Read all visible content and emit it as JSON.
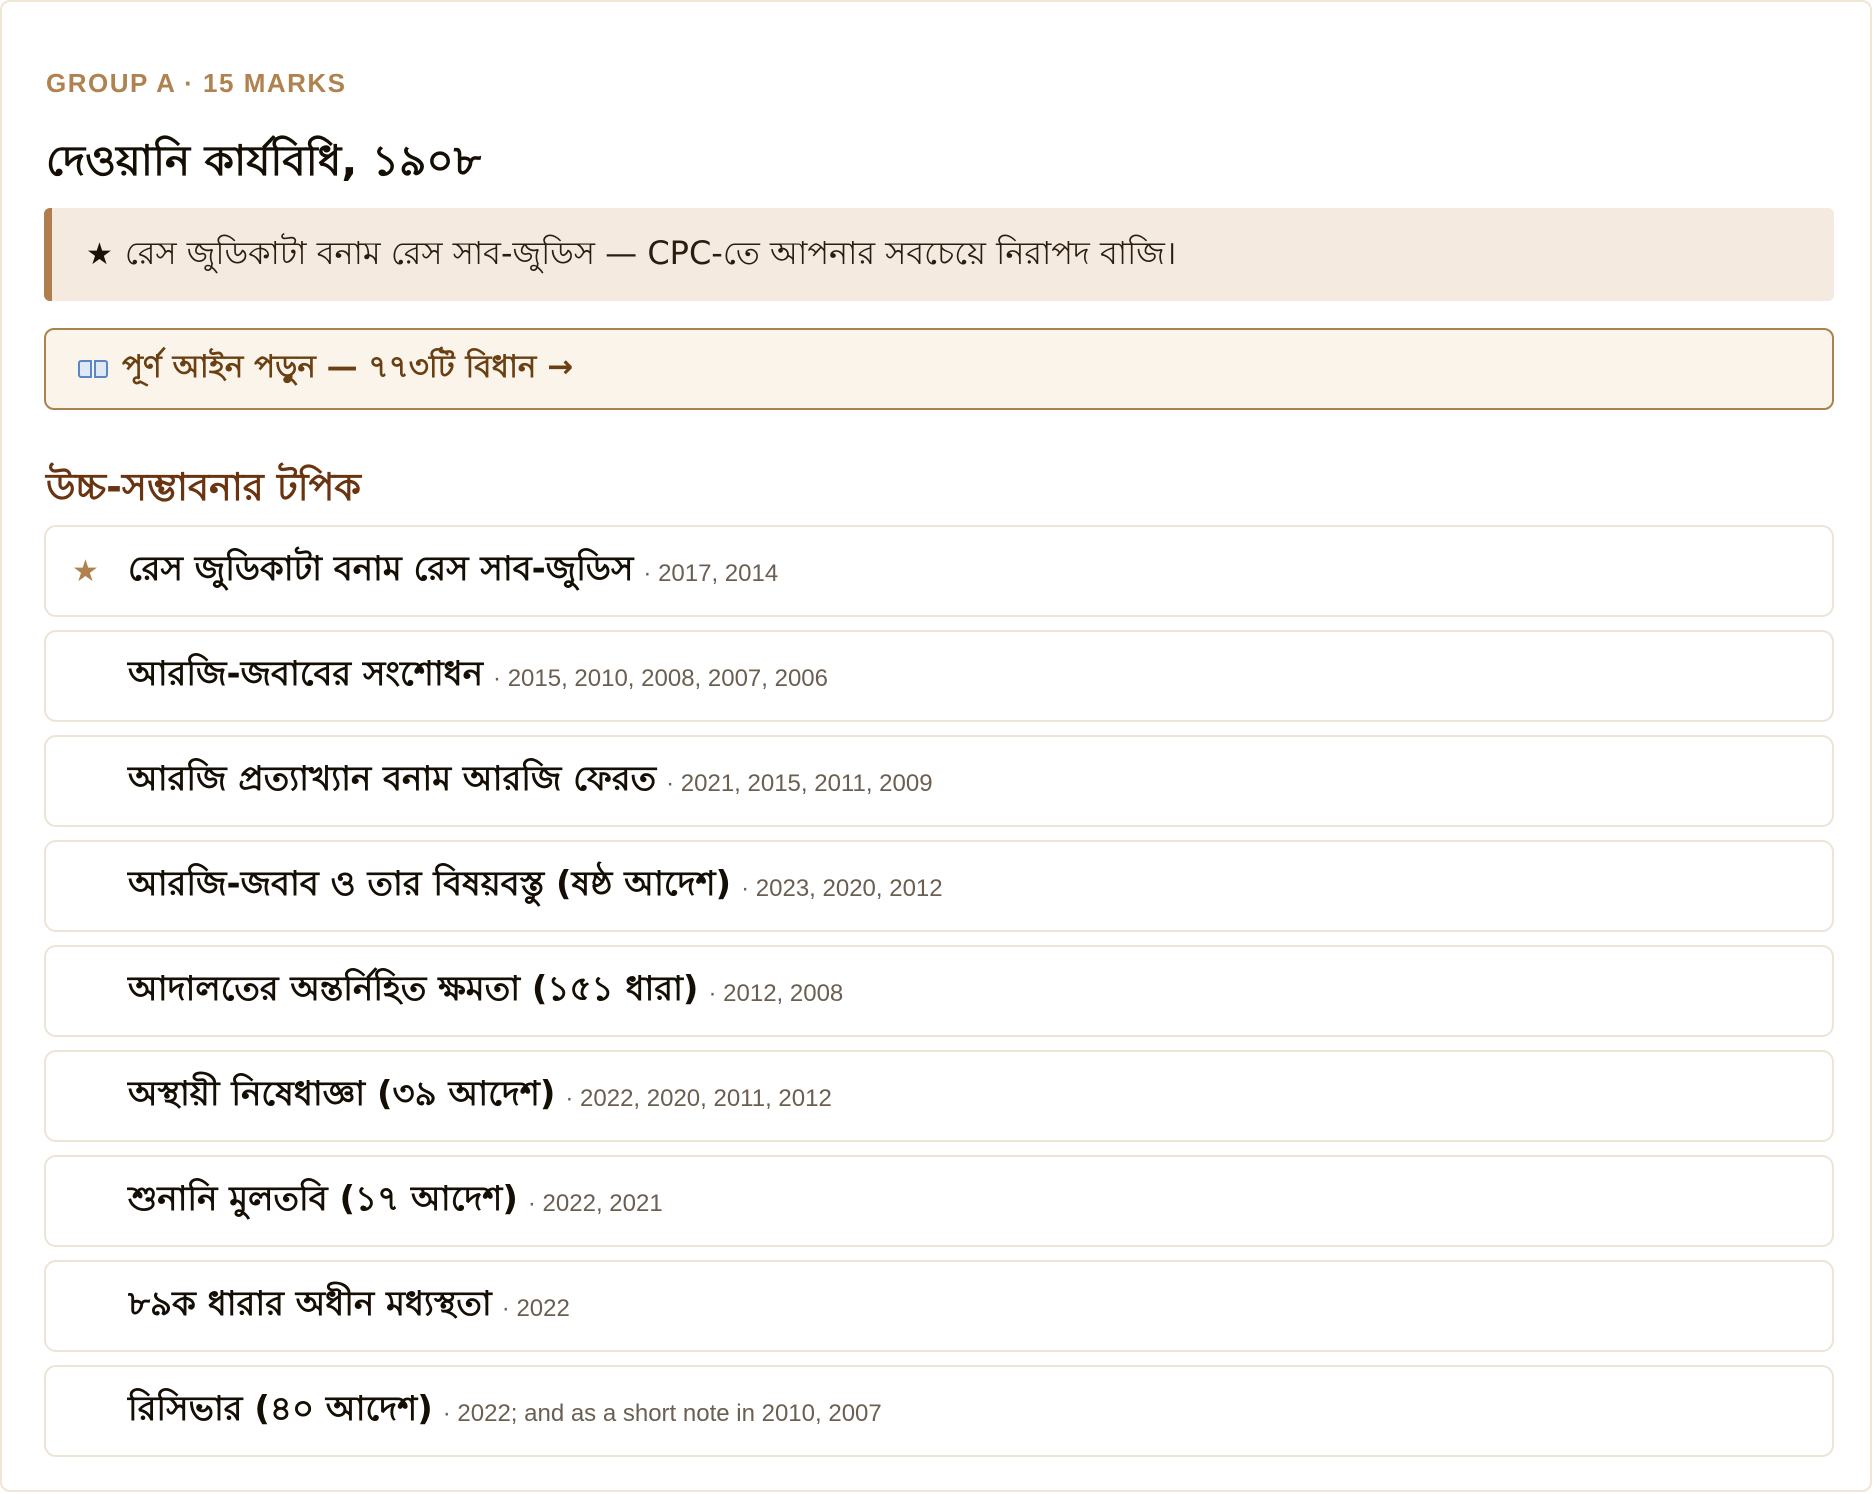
{
  "header": {
    "eyebrow": "GROUP A · 15 MARKS",
    "title": "দেওয়ানি কার্যবিধি, ১৯০৮"
  },
  "tip": {
    "icon": "star-icon",
    "text": "রেস জুডিকাটা বনাম রেস সাব-জুডিস — CPC-তে আপনার সবচেয়ে নিরাপদ বাজি।"
  },
  "read_full": {
    "icon": "open-book-icon",
    "label": "পূর্ণ আইন পড়ুন — ৭৭৩টি বিধান →"
  },
  "section": {
    "heading": "উচ্চ-সম্ভাবনার টপিক"
  },
  "topics": [
    {
      "starred": true,
      "title": "রেস জুডিকাটা বনাম রেস সাব-জুডিস",
      "years": "· 2017, 2014"
    },
    {
      "starred": false,
      "title": "আরজি-জবাবের সংশোধন",
      "years": "· 2015, 2010, 2008, 2007, 2006"
    },
    {
      "starred": false,
      "title": "আরজি প্রত্যাখ্যান বনাম আরজি ফেরত",
      "years": "· 2021, 2015, 2011, 2009"
    },
    {
      "starred": false,
      "title": "আরজি-জবাব ও তার বিষয়বস্তু (ষষ্ঠ আদেশ)",
      "years": "· 2023, 2020, 2012"
    },
    {
      "starred": false,
      "title": "আদালতের অন্তর্নিহিত ক্ষমতা (১৫১ ধারা)",
      "years": "· 2012, 2008"
    },
    {
      "starred": false,
      "title": "অস্থায়ী নিষেধাজ্ঞা (৩৯ আদেশ)",
      "years": "· 2022, 2020, 2011, 2012"
    },
    {
      "starred": false,
      "title": "শুনানি মুলতবি (১৭ আদেশ)",
      "years": "· 2022, 2021"
    },
    {
      "starred": false,
      "title": "৮৯ক ধারার অধীন মধ্যস্থতা",
      "years": "· 2022"
    },
    {
      "starred": false,
      "title": "রিসিভার (৪০ আদেশ)",
      "years": "· 2022; and as a short note in 2010, 2007"
    }
  ],
  "colors": {
    "accent": "#b08250",
    "heading": "#6a3410",
    "tip_bg": "#f4eadf",
    "button_bg": "#fbf4ea",
    "button_border": "#a9834f"
  }
}
